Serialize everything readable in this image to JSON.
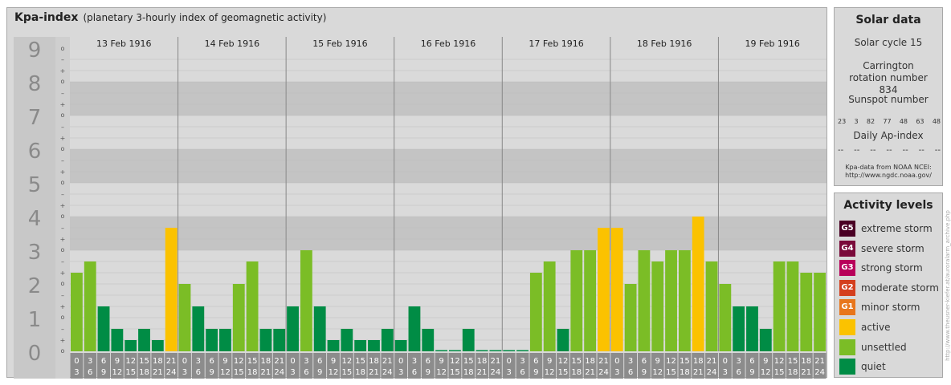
{
  "header": {
    "title": "Kpa-index",
    "subtitle": "(planetary 3-hourly index of geomagnetic activity)"
  },
  "solar": {
    "title": "Solar data",
    "cycle": "Solar cycle 15",
    "carrington": "Carrington rotation number 834",
    "sunspot_title": "Sunspot number",
    "sunspot_values": [
      "23",
      "3",
      "82",
      "77",
      "48",
      "63",
      "48"
    ],
    "ap_title": "Daily Ap-index",
    "ap_values": [
      "--",
      "--",
      "--",
      "--",
      "--",
      "--",
      "--"
    ],
    "credit_line1": "Kpa-data from NOAA NCEI:",
    "credit_line2": "http://www.ngdc.noaa.gov/"
  },
  "levels": {
    "title": "Activity levels",
    "items": [
      {
        "badge": "G5",
        "label": "extreme storm",
        "color": "#4a0024"
      },
      {
        "badge": "G4",
        "label": "severe storm",
        "color": "#7a0a3a"
      },
      {
        "badge": "G3",
        "label": "strong storm",
        "color": "#b8005a"
      },
      {
        "badge": "G2",
        "label": "moderate storm",
        "color": "#d43f1e"
      },
      {
        "badge": "G1",
        "label": "minor storm",
        "color": "#e8761c"
      },
      {
        "badge": "",
        "label": "active",
        "color": "#fbc200"
      },
      {
        "badge": "",
        "label": "unsettled",
        "color": "#7bbd26"
      },
      {
        "badge": "",
        "label": "quiet",
        "color": "#008c45"
      }
    ]
  },
  "watermark": "http://www.theusner-kiefer.at/auroralarm_archive.php",
  "chart_data": {
    "type": "bar",
    "title": "Kpa-index",
    "ylim": [
      0,
      9
    ],
    "y_ticks": [
      "0",
      "1",
      "2",
      "3",
      "4",
      "5",
      "6",
      "7",
      "8",
      "9"
    ],
    "minor_tick_symbols": [
      "o",
      "+",
      "–"
    ],
    "days": [
      "13 Feb 1916",
      "14 Feb 1916",
      "15 Feb 1916",
      "16 Feb 1916",
      "17 Feb 1916",
      "18 Feb 1916",
      "19 Feb 1916"
    ],
    "hour_starts": [
      "0",
      "3",
      "6",
      "9",
      "12",
      "15",
      "18",
      "21"
    ],
    "hour_ends": [
      "3",
      "6",
      "9",
      "12",
      "15",
      "18",
      "21",
      "24"
    ],
    "values": [
      [
        2.333,
        2.667,
        1.333,
        0.667,
        0.333,
        0.667,
        0.333,
        3.667
      ],
      [
        2.0,
        1.333,
        0.667,
        0.667,
        2.0,
        2.667,
        0.667,
        0.667
      ],
      [
        1.333,
        3.0,
        1.333,
        0.333,
        0.667,
        0.333,
        0.333,
        0.667
      ],
      [
        0.333,
        1.333,
        0.667,
        0,
        0,
        0.667,
        0,
        0
      ],
      [
        0,
        0,
        2.333,
        2.667,
        0.667,
        3.0,
        3.0,
        3.667
      ],
      [
        3.667,
        2.0,
        3.0,
        2.667,
        3.0,
        3.0,
        4.0,
        2.667
      ],
      [
        2.0,
        1.333,
        1.333,
        0.667,
        2.667,
        2.667,
        2.333,
        2.333
      ]
    ],
    "thresholds": {
      "unsettled": 1.667,
      "active": 3.333
    }
  }
}
